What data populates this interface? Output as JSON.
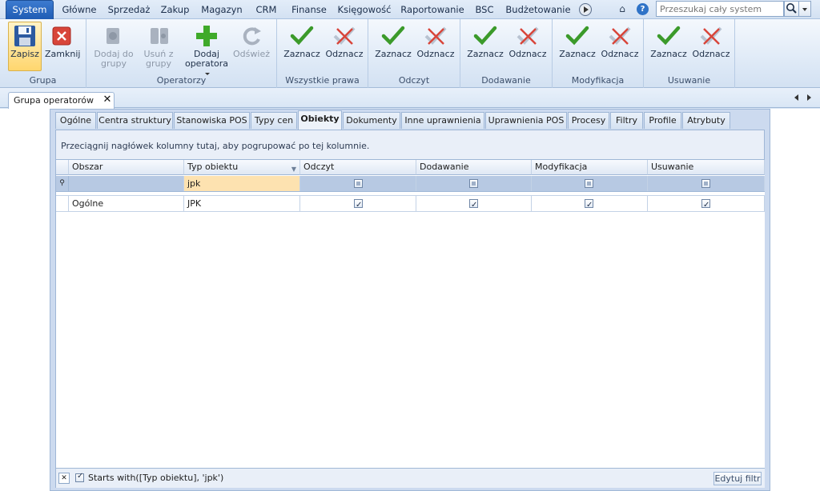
{
  "menu": {
    "items": [
      "System",
      "Główne",
      "Sprzedaż",
      "Zakup",
      "Magazyn",
      "CRM",
      "Finanse",
      "Księgowość",
      "Raportowanie",
      "BSC",
      "Budżetowanie"
    ],
    "active": "System",
    "search_placeholder": "Przeszukaj cały system"
  },
  "ribbon": {
    "groups": [
      {
        "label": "Grupa",
        "buttons": [
          "Zapisz",
          "Zamknij"
        ]
      },
      {
        "label": "Operatorzy",
        "buttons": [
          "Dodaj do grupy",
          "Usuń z grupy",
          "Dodaj operatora",
          "Odśwież"
        ]
      },
      {
        "label": "Wszystkie prawa",
        "buttons": [
          "Zaznacz",
          "Odznacz"
        ]
      },
      {
        "label": "Odczyt",
        "buttons": [
          "Zaznacz",
          "Odznacz"
        ]
      },
      {
        "label": "Dodawanie",
        "buttons": [
          "Zaznacz",
          "Odznacz"
        ]
      },
      {
        "label": "Modyfikacja",
        "buttons": [
          "Zaznacz",
          "Odznacz"
        ]
      },
      {
        "label": "Usuwanie",
        "buttons": [
          "Zaznacz",
          "Odznacz"
        ]
      }
    ],
    "save": {
      "line1": "Zapisz"
    },
    "close": {
      "line1": "Zamknij"
    },
    "add_to_group": {
      "line1": "Dodaj do",
      "line2": "grupy"
    },
    "remove_from_group": {
      "line1": "Usuń z",
      "line2": "grupy"
    },
    "add_operator": {
      "line1": "Dodaj",
      "line2": "operatora"
    },
    "refresh": {
      "line1": "Odśwież"
    },
    "check_label": "Zaznacz",
    "uncheck_label": "Odznacz"
  },
  "document": {
    "tab_title": "Grupa operatorów"
  },
  "tabs": [
    "Ogólne",
    "Centra struktury",
    "Stanowiska POS",
    "Typy cen",
    "Obiekty",
    "Dokumenty",
    "Inne uprawnienia",
    "Uprawnienia POS",
    "Procesy",
    "Filtry",
    "Profile",
    "Atrybuty"
  ],
  "active_tab": "Obiekty",
  "grid": {
    "group_hint": "Przeciągnij nagłówek kolumny tutaj, aby pogrupować po tej kolumnie.",
    "columns": [
      "Obszar",
      "Typ obiektu",
      "Odczyt",
      "Dodawanie",
      "Modyfikacja",
      "Usuwanie"
    ],
    "filter_row": {
      "obszar": "",
      "typ_obiektu": "jpk"
    },
    "rows": [
      {
        "obszar": "Ogólne",
        "typ_obiektu": "JPK",
        "odczyt": true,
        "dodawanie": true,
        "modyfikacja": true,
        "usuwanie": true
      }
    ]
  },
  "filter_bar": {
    "enabled": true,
    "expression": "Starts with([Typ obiektu], 'jpk')",
    "edit_button": "Edytuj filtr"
  }
}
